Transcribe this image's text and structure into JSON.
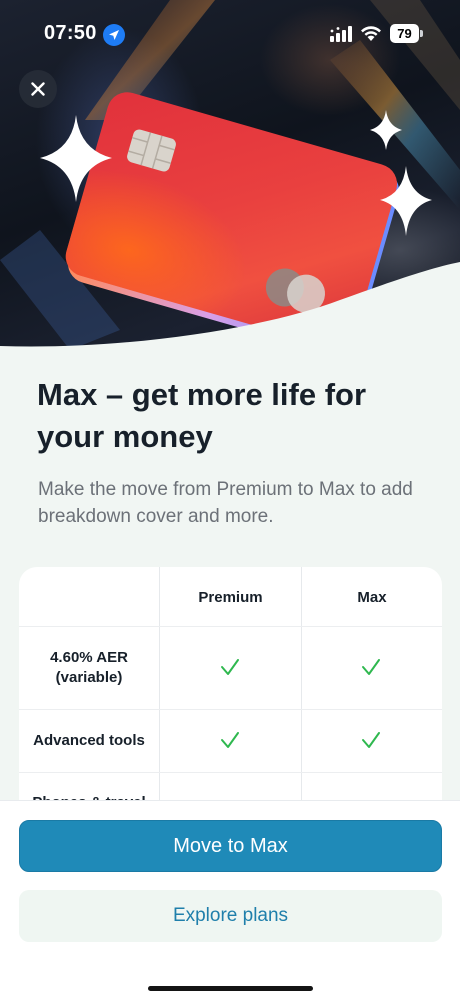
{
  "status": {
    "time": "07:50",
    "battery": "79"
  },
  "headline": "Max – get more life for your money",
  "subtitle": "Make the move from Premium to Max to add breakdown cover and more.",
  "table": {
    "columns": [
      "Premium",
      "Max"
    ],
    "rows": [
      {
        "feature": "4.60% AER (variable)",
        "premium": true,
        "max": true
      },
      {
        "feature": "Advanced tools",
        "premium": true,
        "max": true
      },
      {
        "feature": "Phones & travel",
        "premium": false,
        "max": true
      }
    ]
  },
  "buttons": {
    "primary": "Move to Max",
    "secondary": "Explore plans"
  },
  "colors": {
    "accent": "#1f8ab8",
    "check": "#2fb84f",
    "card": "#e63a3e"
  },
  "icons": [
    "location-arrow-icon",
    "cellular-signal-icon",
    "wifi-icon",
    "battery-icon",
    "close-icon",
    "sparkle-icon",
    "check-icon",
    "chip-icon"
  ]
}
